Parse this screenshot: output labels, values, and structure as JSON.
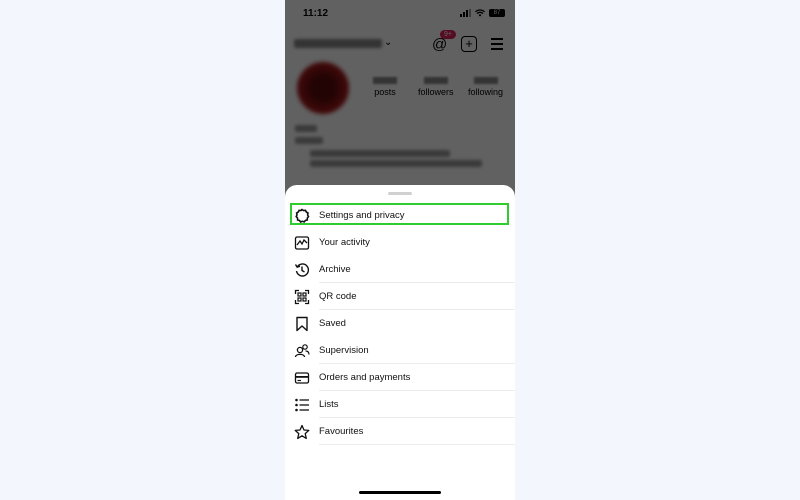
{
  "status_bar": {
    "time": "11:12",
    "battery": "87"
  },
  "profile": {
    "notification_badge": "9+",
    "stats": [
      {
        "label": "posts"
      },
      {
        "label": "followers"
      },
      {
        "label": "following"
      }
    ]
  },
  "menu_sheet": {
    "highlight_color": "#2ecc2e",
    "items": [
      {
        "label": "Settings and privacy",
        "icon": "gear-icon",
        "highlighted": true
      },
      {
        "label": "Your activity",
        "icon": "activity-icon"
      },
      {
        "label": "Archive",
        "icon": "archive-icon"
      },
      {
        "label": "QR code",
        "icon": "qr-code-icon"
      },
      {
        "label": "Saved",
        "icon": "bookmark-icon"
      },
      {
        "label": "Supervision",
        "icon": "supervision-icon"
      },
      {
        "label": "Orders and payments",
        "icon": "card-icon"
      },
      {
        "label": "Lists",
        "icon": "list-icon"
      },
      {
        "label": "Favourites",
        "icon": "star-icon"
      }
    ]
  }
}
